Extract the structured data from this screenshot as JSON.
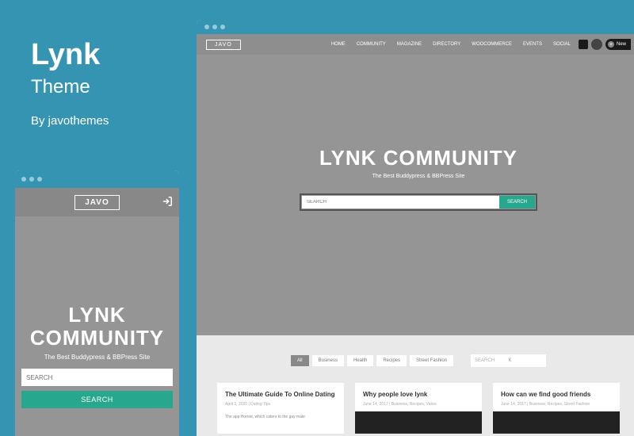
{
  "theme": {
    "title": "Lynk",
    "subtitle": "Theme",
    "by": "By javothemes"
  },
  "brand": "JAVO",
  "hero": {
    "title": "LYNK COMMUNITY",
    "tagline": "The Best Buddypress & BBPress Site",
    "search_ph": "SEARCH",
    "search_btn": "SEARCH"
  },
  "nav": [
    "HOME",
    "COMMUNITY",
    "MAGAZINE",
    "DIRECTORY",
    "WOOCOMMERCE",
    "EVENTS",
    "SOCIAL"
  ],
  "new_label": "New",
  "filters": {
    "chips": [
      "All",
      "Business",
      "Health",
      "Recipes",
      "Street Fashion"
    ],
    "active": 0,
    "search_ph": "SEARCH",
    "kbd": "K"
  },
  "posts": [
    {
      "title": "The Ultimate Guide To Online Dating",
      "meta": "April 3, 2020   |   Dating Tips",
      "excerpt": "The app Hornet, which caters to the gay male"
    },
    {
      "title": "Why people love lynk",
      "meta": "June 14, 2017   |   Business, Recipes, Video",
      "excerpt": ""
    },
    {
      "title": "How can we find good friends",
      "meta": "June 14, 2017   |   Business, Recipes, Street Fashion",
      "excerpt": ""
    }
  ]
}
